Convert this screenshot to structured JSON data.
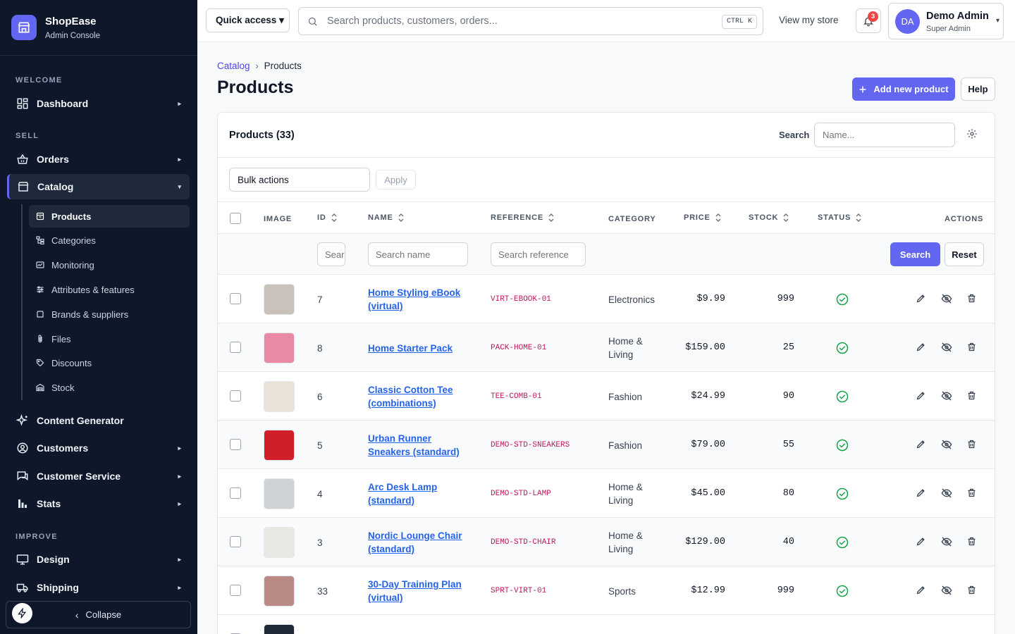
{
  "brand": {
    "name": "ShopEase",
    "subtitle": "Admin Console"
  },
  "sidebar": {
    "sections": {
      "welcome": "WELCOME",
      "sell": "SELL",
      "improve": "IMPROVE"
    },
    "items": {
      "dashboard": "Dashboard",
      "orders": "Orders",
      "catalog": "Catalog",
      "content_generator": "Content Generator",
      "customers": "Customers",
      "customer_service": "Customer Service",
      "stats": "Stats",
      "design": "Design",
      "shipping": "Shipping"
    },
    "catalog_sub": [
      "Products",
      "Categories",
      "Monitoring",
      "Attributes & features",
      "Brands & suppliers",
      "Files",
      "Discounts",
      "Stock"
    ],
    "collapse": "Collapse",
    "carets": {
      "closed": "▸",
      "open": "▾"
    }
  },
  "topbar": {
    "quick_access": "Quick access ▾",
    "search_placeholder": "Search products, customers, orders...",
    "shortcut": "CTRL K",
    "view_store": "View my store",
    "notifications": "3",
    "user": {
      "initials": "DA",
      "name": "Demo Admin",
      "role": "Super Admin",
      "caret": "▾"
    }
  },
  "breadcrumb": {
    "parent": "Catalog",
    "sep": "›",
    "current": "Products"
  },
  "page": {
    "title": "Products",
    "add_button": "Add new product",
    "help_button": "Help"
  },
  "panel": {
    "count_label": "Products (33)",
    "search_label": "Search",
    "search_placeholder": "Name...",
    "bulk_actions": "Bulk actions",
    "apply": "Apply"
  },
  "table": {
    "headers": {
      "image": "IMAGE",
      "id": "ID",
      "name": "NAME",
      "reference": "REFERENCE",
      "category": "CATEGORY",
      "price": "PRICE",
      "stock": "STOCK",
      "status": "STATUS",
      "actions": "ACTIONS"
    },
    "filters": {
      "id_placeholder": "Search ID",
      "name_placeholder": "Search name",
      "ref_placeholder": "Search reference",
      "search": "Search",
      "reset": "Reset"
    },
    "rows": [
      {
        "id": "7",
        "name": "Home Styling eBook (virtual)",
        "reference": "VIRT-EBOOK-01",
        "category": "Electronics",
        "price": "$9.99",
        "stock": "999",
        "status": "active",
        "thumb_color": "#c9c2bb"
      },
      {
        "id": "8",
        "name": "Home Starter Pack",
        "reference": "PACK-HOME-01",
        "category": "Home & Living",
        "price": "$159.00",
        "stock": "25",
        "status": "active",
        "thumb_color": "#e88aa6"
      },
      {
        "id": "6",
        "name": "Classic Cotton Tee (combinations)",
        "reference": "TEE-COMB-01",
        "category": "Fashion",
        "price": "$24.99",
        "stock": "90",
        "status": "active",
        "thumb_color": "#e9e2d8"
      },
      {
        "id": "5",
        "name": "Urban Runner Sneakers (standard)",
        "reference": "DEMO-STD-SNEAKERS",
        "category": "Fashion",
        "price": "$79.00",
        "stock": "55",
        "status": "active",
        "thumb_color": "#d11f2a"
      },
      {
        "id": "4",
        "name": "Arc Desk Lamp (standard)",
        "reference": "DEMO-STD-LAMP",
        "category": "Home & Living",
        "price": "$45.00",
        "stock": "80",
        "status": "active",
        "thumb_color": "#cfd2d4"
      },
      {
        "id": "3",
        "name": "Nordic Lounge Chair (standard)",
        "reference": "DEMO-STD-CHAIR",
        "category": "Home & Living",
        "price": "$129.00",
        "stock": "40",
        "status": "active",
        "thumb_color": "#e6e8e4"
      },
      {
        "id": "33",
        "name": "30-Day Training Plan (virtual)",
        "reference": "SPRT-VIRT-01",
        "category": "Sports",
        "price": "$12.99",
        "stock": "999",
        "status": "active",
        "thumb_color": "#b98a86"
      }
    ]
  },
  "colors": {
    "accent": "#6366f1",
    "sidebar_bg": "#0f172a",
    "status_active": "#16a34a",
    "link": "#2563eb",
    "reference": "#be185d"
  }
}
